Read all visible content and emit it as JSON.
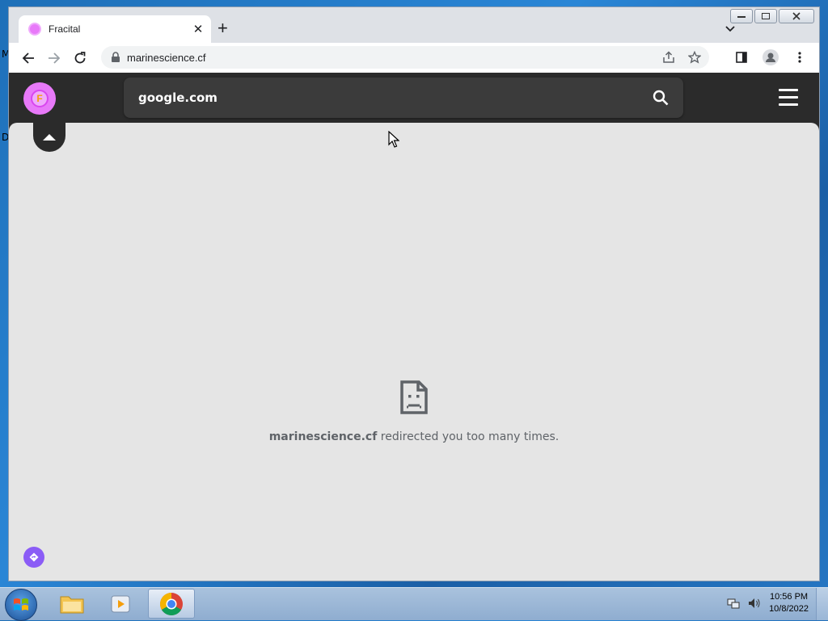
{
  "desktop": {
    "edge_letters": [
      "M",
      "D"
    ]
  },
  "browser": {
    "tab": {
      "title": "Fracital"
    },
    "omnibox": {
      "url": "marinescience.cf"
    }
  },
  "site": {
    "logo_letter": "F",
    "search_value": "google.com"
  },
  "error": {
    "domain": "marinescience.cf",
    "message": " redirected you too many times."
  },
  "taskbar": {
    "clock": {
      "time": "10:56 PM",
      "date": "10/8/2022"
    }
  },
  "colors": {
    "brand": "#e879f9",
    "fab": "#8b5cf6",
    "site_dark": "#2b2b2b"
  }
}
